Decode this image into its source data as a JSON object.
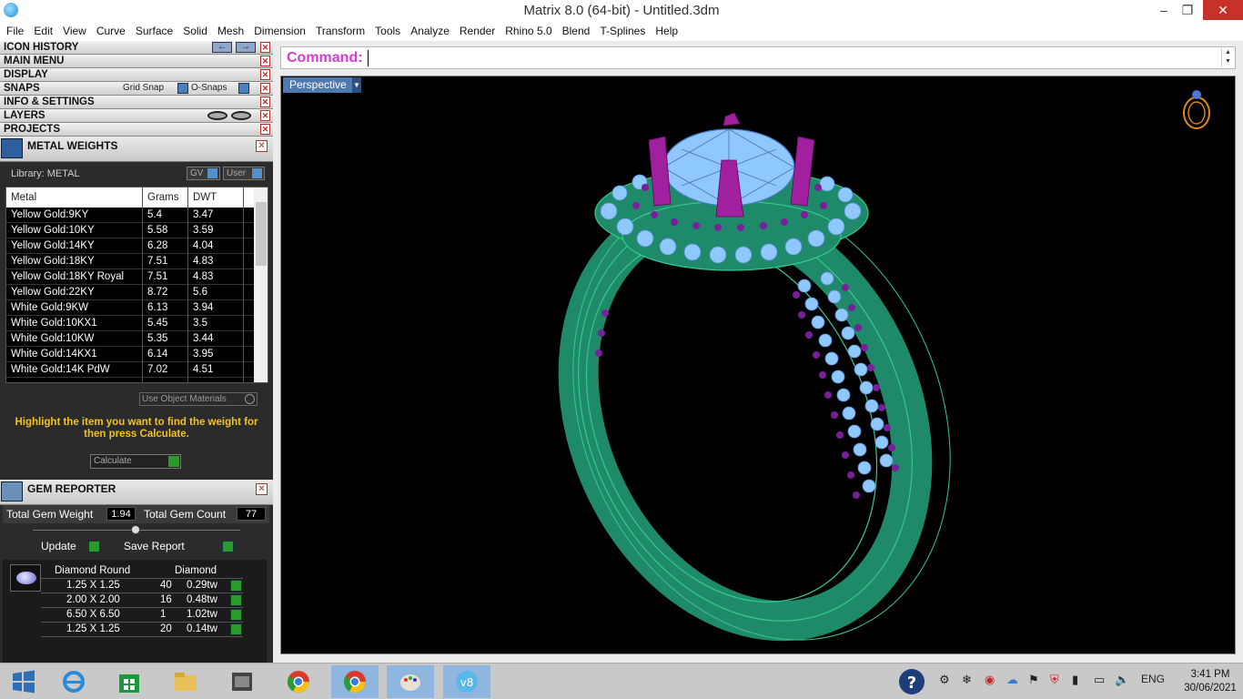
{
  "window": {
    "title": "Matrix 8.0 (64-bit) - Untitled.3dm",
    "minimize": "‒",
    "maximize": "❐",
    "close": "✕"
  },
  "menu": [
    "File",
    "Edit",
    "View",
    "Curve",
    "Surface",
    "Solid",
    "Mesh",
    "Dimension",
    "Transform",
    "Tools",
    "Analyze",
    "Render",
    "Rhino 5.0",
    "Blend",
    "T-Splines",
    "Help"
  ],
  "sections": {
    "icon_history": "ICON HISTORY",
    "main_menu": "MAIN MENU",
    "display": "DISPLAY",
    "snaps": "SNAPS",
    "grid_snap": "Grid Snap",
    "o_snaps": "O-Snaps",
    "info_settings": "INFO & SETTINGS",
    "layers": "LAYERS",
    "projects": "PROJECTS",
    "arrow_left": "←",
    "arrow_right": "→",
    "close_glyph": "✕"
  },
  "metal_weights": {
    "title": "METAL WEIGHTS",
    "library": "Library: METAL",
    "gv": "GV",
    "user": "User",
    "columns": [
      "Metal",
      "Grams",
      "DWT"
    ],
    "rows": [
      [
        "Yellow Gold:9KY",
        "5.4",
        "3.47"
      ],
      [
        "Yellow Gold:10KY",
        "5.58",
        "3.59"
      ],
      [
        "Yellow Gold:14KY",
        "6.28",
        "4.04"
      ],
      [
        "Yellow Gold:18KY",
        "7.51",
        "4.83"
      ],
      [
        "Yellow Gold:18KY Royal",
        "7.51",
        "4.83"
      ],
      [
        "Yellow Gold:22KY",
        "8.72",
        "5.6"
      ],
      [
        "White Gold:9KW",
        "6.13",
        "3.94"
      ],
      [
        "White Gold:10KX1",
        "5.45",
        "3.5"
      ],
      [
        "White Gold:10KW",
        "5.35",
        "3.44"
      ],
      [
        "White Gold:14KX1",
        "6.14",
        "3.95"
      ],
      [
        "White Gold:14K PdW",
        "7.02",
        "4.51"
      ]
    ],
    "use_object_materials": "Use Object Materials",
    "hint": "Highlight the item you want to find the weight for then press Calculate.",
    "calculate": "Calculate"
  },
  "gem_reporter": {
    "title": "GEM REPORTER",
    "total_weight_label": "Total Gem Weight",
    "total_weight": "1.94",
    "total_count_label": "Total Gem Count",
    "total_count": "77",
    "update": "Update",
    "save_report": "Save Report",
    "head_cut": "Diamond Round",
    "head_material": "Diamond",
    "rows": [
      [
        "1.25 X 1.25",
        "40",
        "0.29tw"
      ],
      [
        "2.00 X 2.00",
        "16",
        "0.48tw"
      ],
      [
        "6.50 X 6.50",
        "1",
        "1.02tw"
      ],
      [
        "1.25 X 1.25",
        "20",
        "0.14tw"
      ]
    ]
  },
  "command": {
    "label": "Command:",
    "value": ""
  },
  "viewport": {
    "name": "Perspective",
    "colors": {
      "metal": "#1f8a6a",
      "metal_wire": "#35c98e",
      "diamond": "#8fc8ff",
      "prong": "#a020a0",
      "accent_stone": "#7a1f9a"
    }
  },
  "taskbar": {
    "apps": [
      "windows-start",
      "internet-explorer",
      "store",
      "file-explorer",
      "app-generic",
      "chrome",
      "chrome",
      "paint",
      "matrix"
    ],
    "language": "ENG",
    "time": "3:41 PM",
    "date": "30/06/2021"
  }
}
